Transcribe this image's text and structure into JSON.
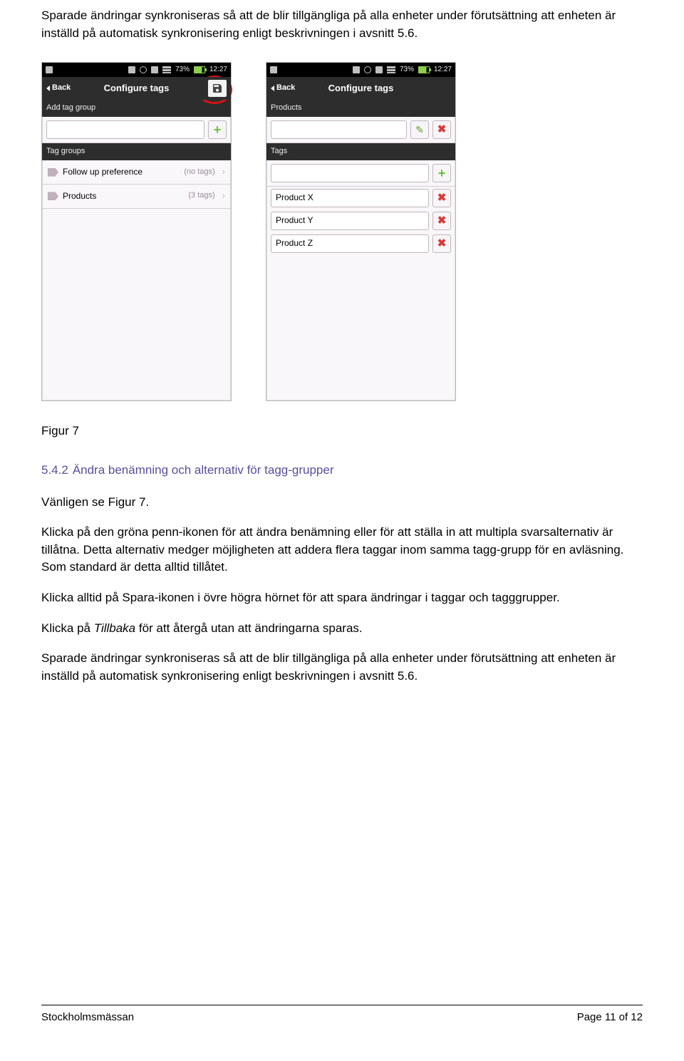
{
  "paragraphs": {
    "intro": "Sparade ändringar synkroniseras så att de blir tillgängliga på alla enheter under förutsättning att enheten är inställd på automatisk synkronisering enligt beskrivningen i avsnitt 5.6.",
    "figure_caption": "Figur 7",
    "section_num": "5.4.2",
    "section_title": "Ändra benämning och alternativ för tagg-grupper",
    "p1": "Vänligen se Figur 7.",
    "p2": "Klicka på den gröna penn-ikonen för att ändra benämning eller för att ställa in att multipla svarsalternativ är tillåtna. Detta alternativ medger möjligheten att addera flera taggar inom samma tagg-grupp för en avläsning. Som standard är detta alltid tillåtet.",
    "p3": "Klicka alltid på Spara-ikonen i övre högra hörnet för att spara ändringar i taggar och tagg­grupper.",
    "p4_pre": "Klicka på ",
    "p4_it": "Tillbaka",
    "p4_post": " för att återgå utan att ändringarna sparas.",
    "p5": "Sparade ändringar synkroniseras så att de blir tillgängliga på alla enheter under förutsättning att enheten är inställd på automatisk synkronisering enligt beskrivningen i avsnitt 5.6."
  },
  "phone": {
    "status_pct": "73%",
    "status_time": "12:27",
    "back_label": "Back",
    "title": "Configure tags"
  },
  "phoneA": {
    "add_group_label": "Add tag group",
    "groups_label": "Tag groups",
    "rows": [
      {
        "name": "Follow up preference",
        "meta": "(no tags)"
      },
      {
        "name": "Products",
        "meta": "(3 tags)"
      }
    ]
  },
  "phoneB": {
    "products_label": "Products",
    "tags_label": "Tags",
    "items": [
      "Product X",
      "Product Y",
      "Product Z"
    ]
  },
  "footer": {
    "left": "Stockholmsmässan",
    "right": "Page 11 of 12"
  }
}
